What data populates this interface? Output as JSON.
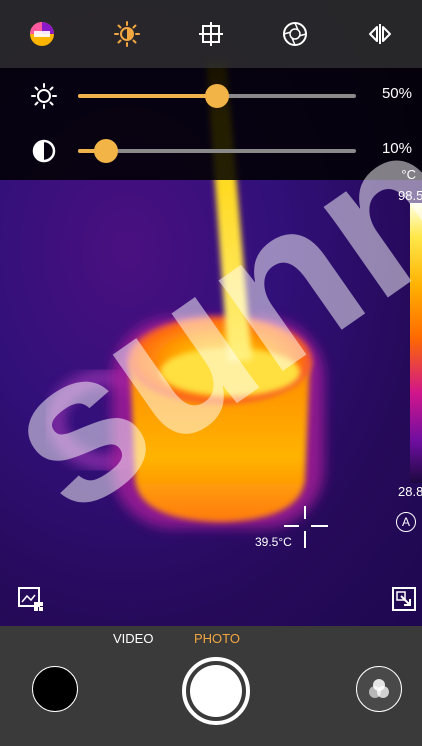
{
  "toolbar": {
    "icons": [
      "palette-icon",
      "brightness-mode-icon",
      "crosshair-target-icon",
      "shutter-iris-icon",
      "mirror-flip-icon"
    ],
    "accent": "#f2a640"
  },
  "sliders": {
    "brightness": {
      "icon": "brightness-icon",
      "value": 0.5,
      "label": "50%"
    },
    "contrast": {
      "icon": "contrast-icon",
      "value": 0.1,
      "label": "10%"
    }
  },
  "scale": {
    "unit": "°C",
    "max": "98.5",
    "min": "28.8",
    "auto_label": "A"
  },
  "measurement": {
    "center_temp": "39.5°C"
  },
  "modes": {
    "video": "VIDEO",
    "photo": "PHOTO",
    "active": "photo"
  },
  "watermark": "sunn"
}
